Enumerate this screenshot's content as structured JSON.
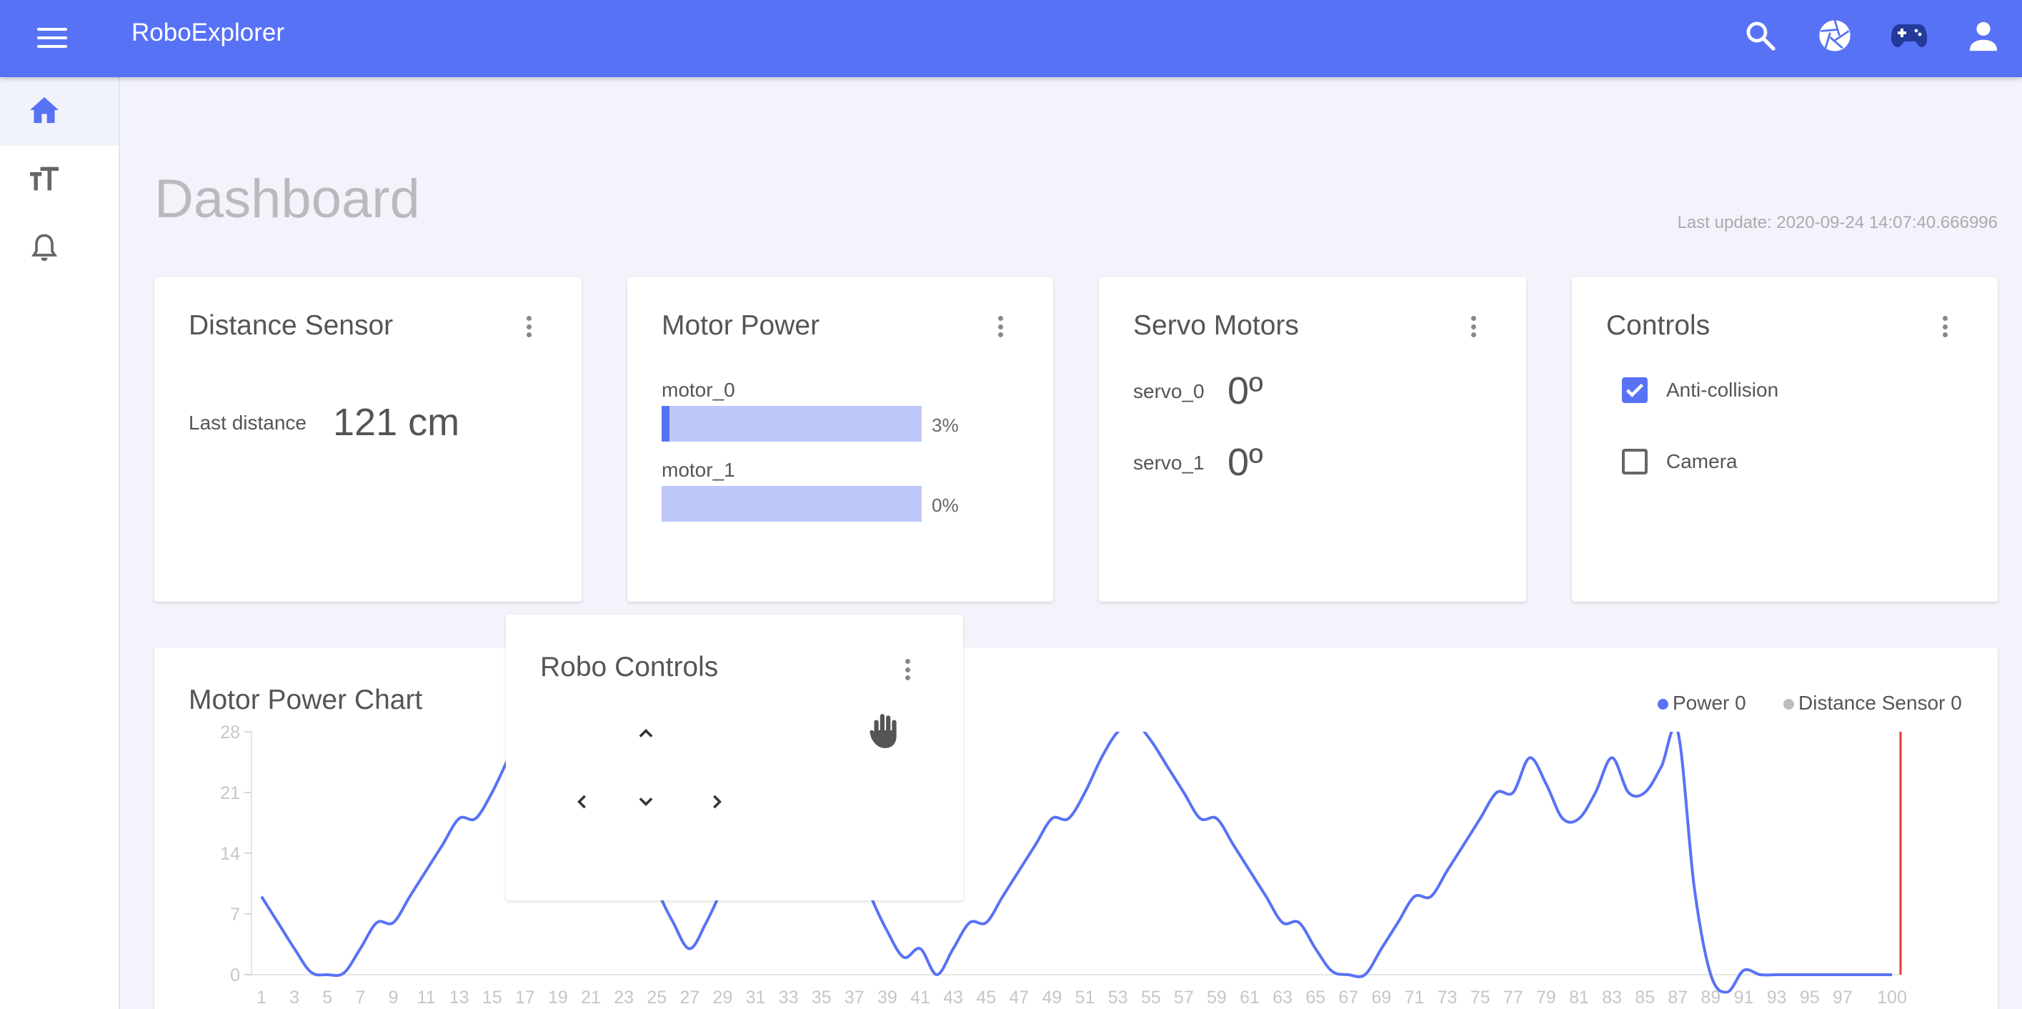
{
  "app": {
    "title": "RoboExplorer"
  },
  "topbar": {
    "icons": [
      "menu-icon",
      "search-icon",
      "aperture-icon",
      "gamepad-icon",
      "account-icon"
    ]
  },
  "sidebar": {
    "items": [
      {
        "name": "home",
        "icon": "home-icon",
        "active": true
      },
      {
        "name": "typography",
        "icon": "text-size-icon",
        "active": false
      },
      {
        "name": "notifications",
        "icon": "bell-icon",
        "active": false
      }
    ]
  },
  "page": {
    "title": "Dashboard",
    "last_update": "Last update: 2020-09-24 14:07:40.666996"
  },
  "distance_card": {
    "title": "Distance Sensor",
    "label": "Last distance",
    "value": "121 cm"
  },
  "motor_card": {
    "title": "Motor Power",
    "motors": [
      {
        "label": "motor_0",
        "percent_text": "3%",
        "fraction": 0.03
      },
      {
        "label": "motor_1",
        "percent_text": "0%",
        "fraction": 0.0
      }
    ]
  },
  "servo_card": {
    "title": "Servo Motors",
    "servos": [
      {
        "label": "servo_0",
        "value": "0º"
      },
      {
        "label": "servo_1",
        "value": "0º"
      }
    ]
  },
  "controls_card": {
    "title": "Controls",
    "options": [
      {
        "label": "Anti-collision",
        "checked": true
      },
      {
        "label": "Camera",
        "checked": false
      }
    ]
  },
  "robo_controls": {
    "title": "Robo Controls",
    "icons": [
      "chevron-up-icon",
      "chevron-left-icon",
      "chevron-down-icon",
      "chevron-right-icon",
      "hand-icon"
    ]
  },
  "colors": {
    "primary": "#5872f6",
    "bar_track": "#bfc8fb",
    "distance_series": "#bdbdbd",
    "marker": "#e53935"
  },
  "chart_data": {
    "type": "line",
    "title": "Motor Power Chart",
    "series": [
      {
        "name": "Power 0",
        "color": "#5872f6"
      },
      {
        "name": "Distance Sensor 0",
        "color": "#bdbdbd"
      }
    ],
    "y_ticks": [
      0,
      7,
      14,
      21,
      28
    ],
    "ylim": [
      0,
      28
    ],
    "x_ticks": [
      "1",
      "3",
      "5",
      "7",
      "9",
      "11",
      "13",
      "15",
      "17",
      "19",
      "21",
      "23",
      "25",
      "27",
      "29",
      "31",
      "33",
      "35",
      "37",
      "39",
      "41",
      "43",
      "45",
      "47",
      "49",
      "51",
      "53",
      "55",
      "57",
      "59",
      "61",
      "63",
      "65",
      "67",
      "69",
      "71",
      "73",
      "75",
      "77",
      "79",
      "81",
      "83",
      "85",
      "87",
      "89",
      "91",
      "93",
      "95",
      "97",
      "100"
    ],
    "x": [
      1,
      2,
      3,
      4,
      5,
      6,
      7,
      8,
      9,
      10,
      11,
      12,
      13,
      14,
      15,
      16,
      17,
      18,
      19,
      20,
      21,
      22,
      23,
      24,
      25,
      26,
      27,
      28,
      29,
      30,
      31,
      32,
      33,
      34,
      35,
      36,
      37,
      38,
      39,
      40,
      41,
      42,
      43,
      44,
      45,
      46,
      47,
      48,
      49,
      50,
      51,
      52,
      53,
      54,
      55,
      56,
      57,
      58,
      59,
      60,
      61,
      62,
      63,
      64,
      65,
      66,
      67,
      68,
      69,
      70,
      71,
      72,
      73,
      74,
      75,
      76,
      77,
      78,
      79,
      80,
      81,
      82,
      83,
      84,
      85,
      86,
      87,
      88,
      89,
      90,
      91,
      92,
      93,
      94,
      95,
      96,
      97,
      98,
      99,
      100
    ],
    "values": [
      9,
      6,
      3,
      0.3,
      0,
      0.2,
      3,
      6,
      6,
      9,
      12,
      15,
      18,
      18,
      21,
      25,
      29,
      30,
      29,
      27,
      25,
      22,
      19,
      16,
      10,
      6,
      3,
      6,
      10,
      14,
      17,
      20,
      23,
      24,
      22,
      18,
      14,
      9,
      5,
      2,
      3,
      0,
      3,
      6,
      6,
      9,
      12,
      15,
      18,
      18,
      21,
      25,
      28,
      29,
      27,
      24,
      21,
      18,
      18,
      15,
      12,
      9,
      6,
      6,
      3,
      0.4,
      0,
      0,
      3,
      6,
      9,
      9,
      12,
      15,
      18,
      21,
      21,
      25,
      22,
      18,
      18,
      21,
      25,
      21,
      21,
      24,
      28,
      10,
      0,
      -2,
      0.5,
      0,
      0,
      0,
      0,
      0,
      0,
      0,
      0,
      0
    ]
  }
}
